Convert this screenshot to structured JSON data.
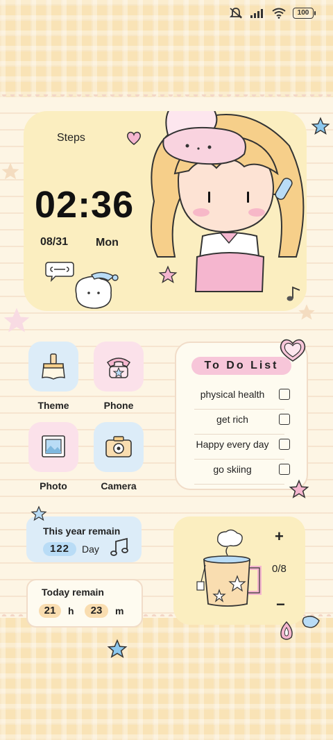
{
  "status_bar": {
    "battery": "100"
  },
  "clock_widget": {
    "steps_label": "Steps",
    "time": "02:36",
    "date": "08/31",
    "weekday": "Mon"
  },
  "apps": [
    {
      "label": "Theme",
      "icon": "paintbrush-icon"
    },
    {
      "label": "Phone",
      "icon": "telephone-icon"
    },
    {
      "label": "Photo",
      "icon": "picture-icon"
    },
    {
      "label": "Camera",
      "icon": "camera-icon"
    }
  ],
  "todo": {
    "title": "To Do List",
    "items": [
      {
        "text": "physical health",
        "checked": false
      },
      {
        "text": "get rich",
        "checked": false
      },
      {
        "text": "Happy every day",
        "checked": false
      },
      {
        "text": "go skiing",
        "checked": false
      }
    ]
  },
  "year_remain": {
    "title": "This year remain",
    "value": "122",
    "unit": "Day"
  },
  "today_remain": {
    "title": "Today remain",
    "hours": "21",
    "hours_unit": "h",
    "minutes": "23",
    "minutes_unit": "m"
  },
  "water": {
    "plus": "+",
    "count": "0/8",
    "minus": "−"
  },
  "colors": {
    "accent_pink": "#f7c6d9",
    "card_yellow": "#fbeec0",
    "card_blue": "#dcecf8",
    "pill_orange": "#f9ddb0"
  }
}
